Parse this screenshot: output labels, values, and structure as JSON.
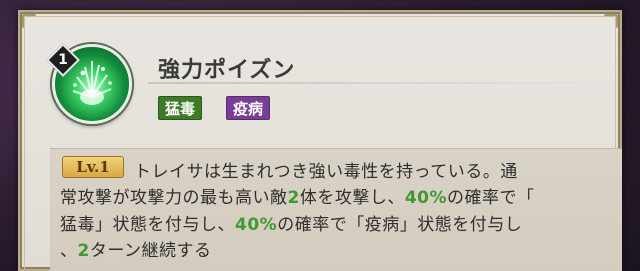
{
  "skill": {
    "level_number": "1",
    "name": "強力ポイズン",
    "icon": "poison-skill-icon",
    "tags": [
      {
        "label": "猛毒",
        "color": "#3e7a2a"
      },
      {
        "label": "疫病",
        "color": "#7a3d96"
      }
    ],
    "lv_label": "Lv.1",
    "description": {
      "line1": "トレイサは生まれつき強い毒性を持っている。通",
      "line2a": "常攻撃が攻撃力の最も高い敵",
      "line2_num": "2",
      "line2b": "体を攻撃し、",
      "line2_pct": "40%",
      "line2c": "の確率で「",
      "line3a": "猛毒」状態を付与し、",
      "line3_pct": "40%",
      "line3b": "の確率で「疫病」状態を付与し",
      "line4a": "、",
      "line4_num": "2",
      "line4b": "ターン継続する"
    }
  },
  "colors": {
    "highlight": "#3f9a32",
    "panel": "#e6e2dc",
    "desc_box": "#d7d0c4"
  }
}
